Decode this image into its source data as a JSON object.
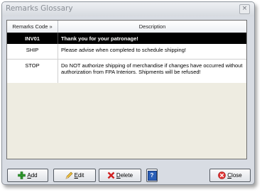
{
  "window": {
    "title": "Remarks Glossary",
    "close_glyph": "×"
  },
  "grid": {
    "columns": [
      "Remarks Code »",
      "Description"
    ],
    "rows": [
      {
        "code": "INV01",
        "description": "Thank you for your patronage!",
        "selected": true
      },
      {
        "code": "SHIP",
        "description": "Please advise when completed to schedule shipping!",
        "selected": false
      },
      {
        "code": "STOP",
        "description": "Do NOT authorize shipping of merchandise if changes have occurred without authorization from FPA Interiors.  Shipments will be refused!",
        "selected": false
      }
    ]
  },
  "buttons": {
    "add": {
      "accel": "A",
      "rest": "dd",
      "icon": "plus-icon"
    },
    "edit": {
      "accel": "E",
      "rest": "dit",
      "icon": "pencil-icon"
    },
    "delete": {
      "accel": "D",
      "rest": "elete",
      "icon": "delete-x-icon"
    },
    "help": {
      "icon": "help-icon",
      "glyph": "?"
    },
    "close": {
      "accel": "C",
      "rest": "lose",
      "icon": "close-circle-icon"
    }
  },
  "colors": {
    "selected_row_bg": "#000000",
    "grid_empty_bg": "#eeece1",
    "window_bg": "#d8dce3"
  }
}
